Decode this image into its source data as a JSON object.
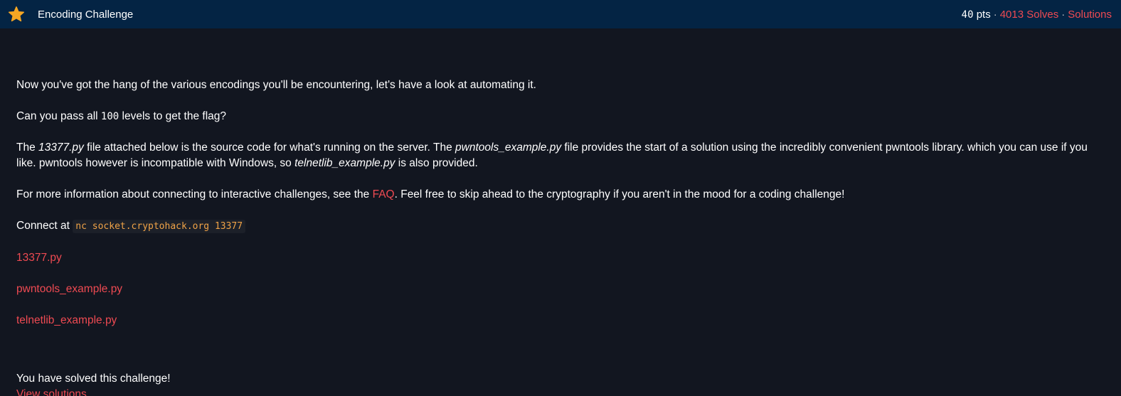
{
  "header": {
    "title": "Encoding Challenge",
    "points_value": "40",
    "points_unit": " pts",
    "separator": "·",
    "solves_label": "4013 Solves",
    "solutions_label": "Solutions",
    "icon": "star-icon"
  },
  "description": {
    "p1": "Now you've got the hang of the various encodings you'll be encountering, let's have a look at automating it.",
    "p2_prefix": "Can you pass all ",
    "p2_number": "100",
    "p2_suffix": " levels to get the flag?",
    "p3_part1": "The ",
    "p3_file1": "13377.py",
    "p3_part2": " file attached below is the source code for what's running on the server. The ",
    "p3_file2": "pwntools_example.py",
    "p3_part3": " file provides the start of a solution using the incredibly convenient pwntools library. which you can use if you like. pwntools however is incompatible with Windows, so ",
    "p3_file3": "telnetlib_example.py",
    "p3_part4": " is also provided.",
    "p4_prefix": "For more information about connecting to interactive challenges, see the ",
    "p4_link": "FAQ",
    "p4_suffix": ". Feel free to skip ahead to the cryptography if you aren't in the mood for a coding challenge!",
    "connect_label": "Connect at ",
    "connect_command": "nc socket.cryptohack.org 13377"
  },
  "files": [
    "13377.py",
    "pwntools_example.py",
    "telnetlib_example.py"
  ],
  "status": {
    "solved_text": "You have solved this challenge!",
    "view_solutions_label": "View solutions"
  },
  "colors": {
    "header_bg": "#042444",
    "page_bg": "#121620",
    "accent_red": "#ef4a52",
    "star": "#f5a623",
    "code_text": "#f0a347"
  }
}
